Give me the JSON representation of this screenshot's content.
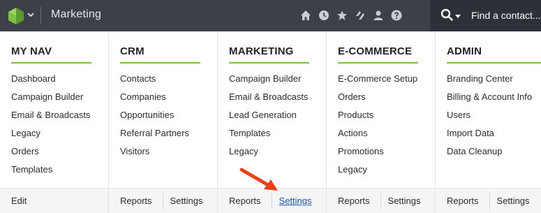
{
  "topbar": {
    "title": "Marketing",
    "icons": [
      "home-icon",
      "clock-icon",
      "star-icon",
      "tags-icon",
      "user-icon",
      "help-icon"
    ],
    "search_placeholder": "Find a contact..."
  },
  "columns": [
    {
      "heading": "MY NAV",
      "links": [
        "Dashboard",
        "Campaign Builder",
        "Email & Broadcasts",
        "Legacy",
        "Orders",
        "Templates"
      ],
      "footer": [
        "Edit"
      ]
    },
    {
      "heading": "CRM",
      "links": [
        "Contacts",
        "Companies",
        "Opportunities",
        "Referral Partners",
        "Visitors"
      ],
      "footer": [
        "Reports",
        "Settings"
      ]
    },
    {
      "heading": "MARKETING",
      "links": [
        "Campaign Builder",
        "Email & Broadcasts",
        "Lead Generation",
        "Templates",
        "Legacy"
      ],
      "footer": [
        "Reports",
        "Settings"
      ]
    },
    {
      "heading": "E-COMMERCE",
      "links": [
        "E-Commerce Setup",
        "Orders",
        "Products",
        "Actions",
        "Promotions",
        "Legacy"
      ],
      "footer": [
        "Reports",
        "Settings"
      ]
    },
    {
      "heading": "ADMIN",
      "links": [
        "Branding Center",
        "Billing & Account Info",
        "Users",
        "Import Data",
        "Data Cleanup"
      ],
      "footer": [
        "Reports",
        "Settings"
      ]
    }
  ],
  "colors": {
    "topbar": "#3c4149",
    "accent_green": "#7cc142",
    "active_link": "#1b55a8",
    "arrow": "#e8401c"
  }
}
